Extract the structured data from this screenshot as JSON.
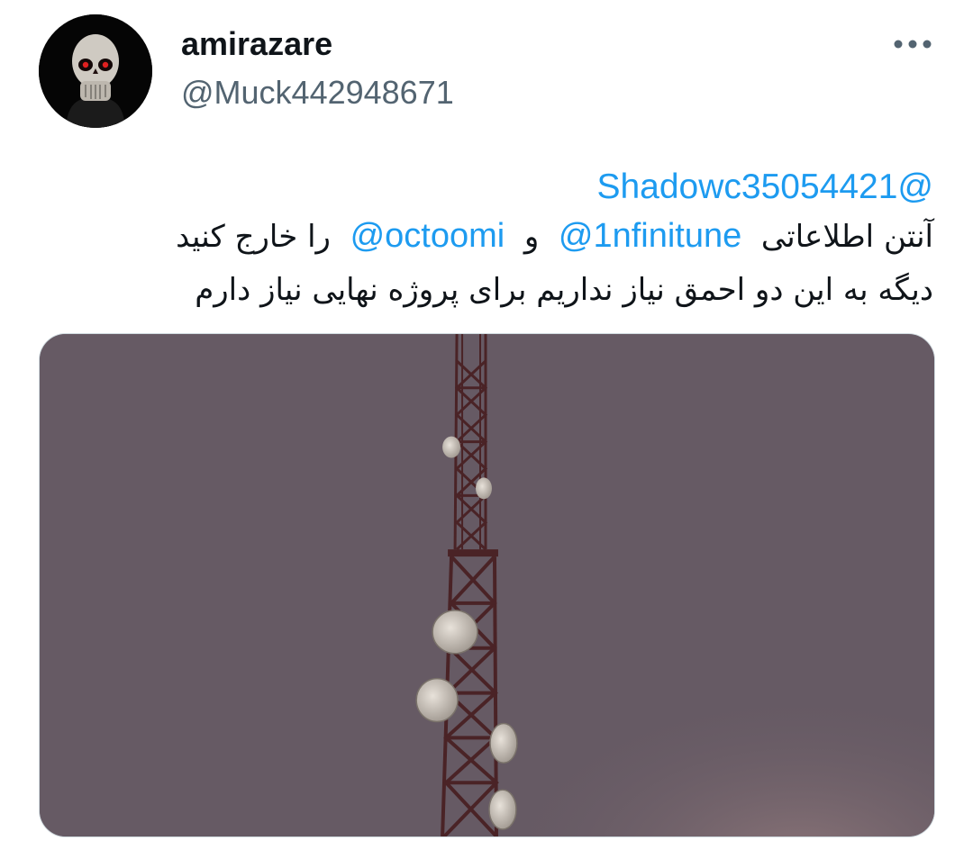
{
  "author": {
    "display_name": "amirazare",
    "handle": "@Muck442948671",
    "avatar_icon": "skull-avatar-icon"
  },
  "more_icon": "more-horizontal-icon",
  "tweet": {
    "reply_to": "@Shadowc35054421",
    "line2_prefix": "آنتن اطلاعاتی",
    "mention_1": "@1nfinitune",
    "line2_conjunction": "و",
    "mention_2": "@octoomi",
    "line2_suffix": "را خارج کنید",
    "line3": "دیگه به این دو احمق نیاز نداریم برای پروژه نهایی نیاز دارم"
  },
  "media": {
    "icon": "antenna-tower-photo",
    "sky_color": "#665a64",
    "tower_color": "#4a2326"
  },
  "colors": {
    "text": "#0f1419",
    "secondary": "#536471",
    "link": "#1d9bf0",
    "border": "#cfd9de"
  }
}
